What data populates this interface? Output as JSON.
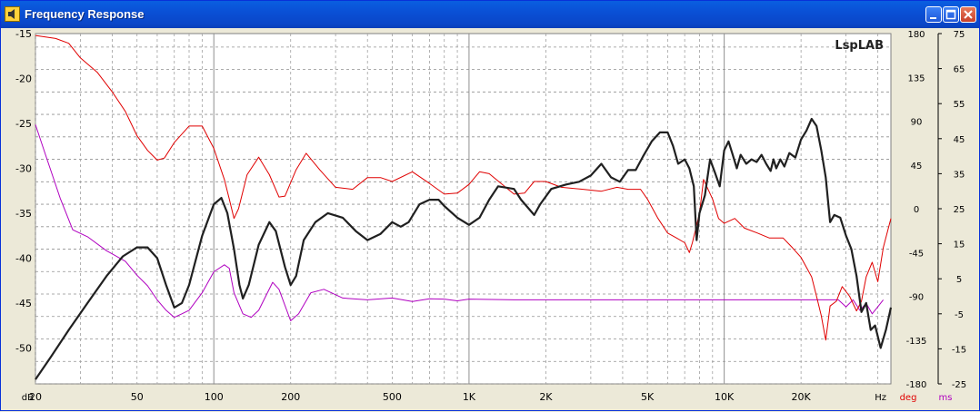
{
  "window": {
    "title": "Frequency Response"
  },
  "chart_data": {
    "type": "line",
    "watermark": "LspLAB",
    "x_scale": "log",
    "xlim": [
      20,
      45000
    ],
    "x_unit": "Hz",
    "x_ticks": [
      {
        "v": 20,
        "label": "20"
      },
      {
        "v": 50,
        "label": "50"
      },
      {
        "v": 100,
        "label": "100"
      },
      {
        "v": 200,
        "label": "200"
      },
      {
        "v": 500,
        "label": "500"
      },
      {
        "v": 1000,
        "label": "1K"
      },
      {
        "v": 2000,
        "label": "2K"
      },
      {
        "v": 5000,
        "label": "5K"
      },
      {
        "v": 10000,
        "label": "10K"
      },
      {
        "v": 20000,
        "label": "20K"
      }
    ],
    "left_axis": {
      "unit": "dB",
      "ylim": [
        -54,
        -15
      ],
      "ticks": [
        "-15",
        "-20",
        "-25",
        "-30",
        "-35",
        "-40",
        "-45",
        "-50"
      ],
      "tick_values": [
        -15,
        -20,
        -25,
        -30,
        -35,
        -40,
        -45,
        -50
      ]
    },
    "right_axis_deg": {
      "unit": "deg",
      "ylim": [
        -180,
        180
      ],
      "ticks": [
        "180",
        "135",
        "90",
        "45",
        "0",
        "-45",
        "-90",
        "-135",
        "-180"
      ],
      "tick_values": [
        180,
        135,
        90,
        45,
        0,
        -45,
        -90,
        -135,
        -180
      ]
    },
    "right_axis_ms": {
      "unit": "ms",
      "ylim": [
        -25,
        75
      ],
      "ticks": [
        "75",
        "65",
        "55",
        "45",
        "35",
        "25",
        "15",
        "5",
        "-5",
        "-15",
        "-25"
      ],
      "tick_values": [
        75,
        65,
        55,
        45,
        35,
        25,
        15,
        5,
        -5,
        -15,
        -25
      ]
    },
    "grid": true,
    "colors": {
      "magnitude": "#202020",
      "phase": "#e00000",
      "group_delay": "#b000c0",
      "deg_label": "#e00000",
      "ms_label": "#b000c0"
    },
    "series": [
      {
        "axis": "dB",
        "points": [
          [
            20,
            -53.5
          ],
          [
            23,
            -51
          ],
          [
            27,
            -48
          ],
          [
            32,
            -45
          ],
          [
            38,
            -42
          ],
          [
            44,
            -39.8
          ],
          [
            50,
            -38.8
          ],
          [
            55,
            -38.8
          ],
          [
            60,
            -40
          ],
          [
            65,
            -43
          ],
          [
            70,
            -45.5
          ],
          [
            75,
            -45
          ],
          [
            80,
            -43
          ],
          [
            90,
            -37.5
          ],
          [
            100,
            -34
          ],
          [
            107,
            -33.3
          ],
          [
            113,
            -35
          ],
          [
            120,
            -39
          ],
          [
            126,
            -43
          ],
          [
            130,
            -44.5
          ],
          [
            137,
            -43
          ],
          [
            150,
            -38.5
          ],
          [
            165,
            -36
          ],
          [
            175,
            -37
          ],
          [
            190,
            -41
          ],
          [
            200,
            -43
          ],
          [
            210,
            -42
          ],
          [
            225,
            -38
          ],
          [
            250,
            -36
          ],
          [
            280,
            -35
          ],
          [
            320,
            -35.5
          ],
          [
            360,
            -37
          ],
          [
            400,
            -38
          ],
          [
            450,
            -37.3
          ],
          [
            500,
            -36
          ],
          [
            540,
            -36.5
          ],
          [
            580,
            -36
          ],
          [
            640,
            -34
          ],
          [
            700,
            -33.5
          ],
          [
            760,
            -33.5
          ],
          [
            800,
            -34.2
          ],
          [
            900,
            -35.5
          ],
          [
            1000,
            -36.3
          ],
          [
            1100,
            -35.5
          ],
          [
            1200,
            -33.5
          ],
          [
            1300,
            -32
          ],
          [
            1500,
            -32.3
          ],
          [
            1600,
            -33.5
          ],
          [
            1800,
            -35.2
          ],
          [
            1900,
            -34
          ],
          [
            2100,
            -32.3
          ],
          [
            2400,
            -31.8
          ],
          [
            2700,
            -31.5
          ],
          [
            3000,
            -30.8
          ],
          [
            3300,
            -29.5
          ],
          [
            3600,
            -31
          ],
          [
            3900,
            -31.5
          ],
          [
            4200,
            -30.2
          ],
          [
            4500,
            -30.2
          ],
          [
            4800,
            -28.7
          ],
          [
            5200,
            -27
          ],
          [
            5600,
            -26
          ],
          [
            6000,
            -26
          ],
          [
            6300,
            -27.5
          ],
          [
            6600,
            -29.5
          ],
          [
            7000,
            -29
          ],
          [
            7300,
            -30
          ],
          [
            7600,
            -32
          ],
          [
            7800,
            -38
          ],
          [
            8000,
            -35
          ],
          [
            8400,
            -33
          ],
          [
            8800,
            -29
          ],
          [
            9200,
            -30.5
          ],
          [
            9600,
            -32
          ],
          [
            10000,
            -28
          ],
          [
            10400,
            -27
          ],
          [
            10800,
            -28.5
          ],
          [
            11200,
            -30
          ],
          [
            11600,
            -28.5
          ],
          [
            12200,
            -29.5
          ],
          [
            12800,
            -29
          ],
          [
            13400,
            -29.3
          ],
          [
            14000,
            -28.5
          ],
          [
            14600,
            -29.5
          ],
          [
            15200,
            -30.3
          ],
          [
            15600,
            -29
          ],
          [
            16000,
            -30
          ],
          [
            16600,
            -29
          ],
          [
            17200,
            -29.8
          ],
          [
            18000,
            -28.3
          ],
          [
            19000,
            -28.8
          ],
          [
            20000,
            -26.8
          ],
          [
            21000,
            -25.8
          ],
          [
            22000,
            -24.5
          ],
          [
            23000,
            -25.3
          ],
          [
            24000,
            -28
          ],
          [
            25000,
            -31
          ],
          [
            26000,
            -36
          ],
          [
            27000,
            -35.2
          ],
          [
            28500,
            -35.5
          ],
          [
            30000,
            -37.5
          ],
          [
            31500,
            -39
          ],
          [
            33000,
            -42
          ],
          [
            34500,
            -46
          ],
          [
            36000,
            -45
          ],
          [
            37500,
            -48
          ],
          [
            39000,
            -47.5
          ],
          [
            41000,
            -50
          ],
          [
            43000,
            -48
          ],
          [
            45000,
            -45.5
          ]
        ]
      },
      {
        "axis": "deg",
        "points": [
          [
            20,
            178
          ],
          [
            24,
            175
          ],
          [
            27,
            170
          ],
          [
            30,
            155
          ],
          [
            35,
            140
          ],
          [
            40,
            120
          ],
          [
            45,
            100
          ],
          [
            50,
            75
          ],
          [
            55,
            60
          ],
          [
            60,
            50
          ],
          [
            64,
            52
          ],
          [
            70,
            68
          ],
          [
            80,
            85
          ],
          [
            90,
            85
          ],
          [
            100,
            62
          ],
          [
            110,
            30
          ],
          [
            115,
            10
          ],
          [
            120,
            -10
          ],
          [
            125,
            0
          ],
          [
            135,
            35
          ],
          [
            150,
            53
          ],
          [
            165,
            35
          ],
          [
            180,
            12
          ],
          [
            190,
            13
          ],
          [
            210,
            40
          ],
          [
            230,
            57
          ],
          [
            260,
            40
          ],
          [
            300,
            22
          ],
          [
            350,
            20
          ],
          [
            400,
            32
          ],
          [
            450,
            32
          ],
          [
            500,
            28
          ],
          [
            600,
            38
          ],
          [
            700,
            26
          ],
          [
            800,
            15
          ],
          [
            900,
            16
          ],
          [
            1000,
            25
          ],
          [
            1100,
            38
          ],
          [
            1200,
            36
          ],
          [
            1350,
            25
          ],
          [
            1500,
            15
          ],
          [
            1650,
            16
          ],
          [
            1800,
            28
          ],
          [
            2000,
            28
          ],
          [
            2300,
            22
          ],
          [
            2800,
            20
          ],
          [
            3300,
            18
          ],
          [
            3800,
            22
          ],
          [
            4200,
            20
          ],
          [
            4700,
            20
          ],
          [
            5000,
            10
          ],
          [
            5500,
            -10
          ],
          [
            6000,
            -25
          ],
          [
            6500,
            -30
          ],
          [
            7000,
            -35
          ],
          [
            7300,
            -45
          ],
          [
            7500,
            -35
          ],
          [
            8000,
            -5
          ],
          [
            8300,
            30
          ],
          [
            9000,
            10
          ],
          [
            9500,
            -10
          ],
          [
            10000,
            -15
          ],
          [
            11000,
            -10
          ],
          [
            12000,
            -20
          ],
          [
            13500,
            -25
          ],
          [
            15000,
            -30
          ],
          [
            17000,
            -30
          ],
          [
            18500,
            -40
          ],
          [
            20000,
            -50
          ],
          [
            22000,
            -70
          ],
          [
            23000,
            -90
          ],
          [
            24000,
            -110
          ],
          [
            25000,
            -135
          ],
          [
            26000,
            -100
          ],
          [
            27500,
            -95
          ],
          [
            29000,
            -80
          ],
          [
            31000,
            -90
          ],
          [
            33000,
            -105
          ],
          [
            34500,
            -95
          ],
          [
            36000,
            -70
          ],
          [
            38000,
            -55
          ],
          [
            40000,
            -75
          ],
          [
            42000,
            -40
          ],
          [
            45000,
            -10
          ]
        ]
      },
      {
        "axis": "ms",
        "points": [
          [
            20,
            49
          ],
          [
            22,
            40
          ],
          [
            25,
            28
          ],
          [
            28,
            19
          ],
          [
            32,
            17
          ],
          [
            38,
            13
          ],
          [
            45,
            10
          ],
          [
            50,
            6
          ],
          [
            55,
            3
          ],
          [
            60,
            -1
          ],
          [
            65,
            -4
          ],
          [
            70,
            -6
          ],
          [
            75,
            -5
          ],
          [
            80,
            -4
          ],
          [
            90,
            1
          ],
          [
            100,
            7
          ],
          [
            110,
            9
          ],
          [
            115,
            8
          ],
          [
            120,
            1
          ],
          [
            130,
            -5
          ],
          [
            140,
            -6
          ],
          [
            150,
            -4
          ],
          [
            170,
            4
          ],
          [
            180,
            2
          ],
          [
            200,
            -7
          ],
          [
            215,
            -5
          ],
          [
            240,
            1
          ],
          [
            270,
            2
          ],
          [
            320,
            -0.5
          ],
          [
            400,
            -1
          ],
          [
            500,
            -0.5
          ],
          [
            600,
            -1.5
          ],
          [
            700,
            -0.7
          ],
          [
            800,
            -0.8
          ],
          [
            900,
            -1.3
          ],
          [
            1000,
            -0.8
          ],
          [
            1500,
            -1
          ],
          [
            2000,
            -1
          ],
          [
            3000,
            -1
          ],
          [
            5000,
            -1
          ],
          [
            8000,
            -1
          ],
          [
            10000,
            -1
          ],
          [
            15000,
            -1
          ],
          [
            20000,
            -1
          ],
          [
            25000,
            -1
          ],
          [
            28000,
            -1
          ],
          [
            30000,
            -3
          ],
          [
            32000,
            -1
          ],
          [
            34000,
            -4
          ],
          [
            36000,
            -2
          ],
          [
            38000,
            -5
          ],
          [
            40000,
            -3
          ],
          [
            42000,
            -1
          ]
        ]
      }
    ]
  }
}
